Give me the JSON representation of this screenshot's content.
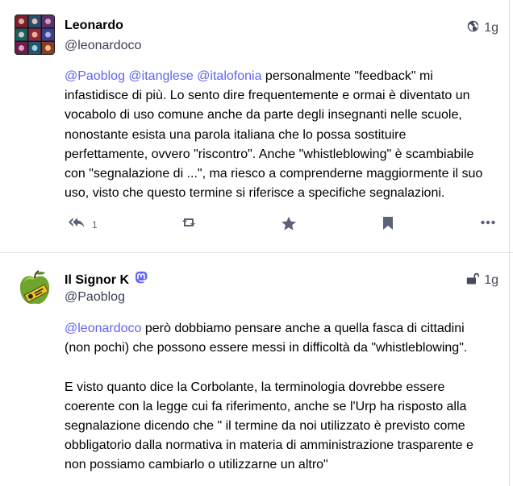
{
  "posts": [
    {
      "author": "Leonardo",
      "handle": "@leonardoco",
      "visibility_icon": "globe-icon",
      "time": "1g",
      "mentions": [
        "@Paoblog",
        "@itanglese",
        "@italofonia"
      ],
      "text": " personalmente \"feedback\" mi infastidisce di più. Lo sento dire frequentemente e ormai è diventato un vocabolo di uso comune anche da parte degli insegnanti nelle scuole, nonostante esista una parola italiana che lo possa sostituire perfettamente, ovvero \"riscontro\". Anche \"whistleblowing\"  è scambiabile con \"segnalazione di ...\", ma riesco a comprenderne maggiormente il suo uso, visto che questo termine si riferisce a specifiche segnalazioni.",
      "reply_count": "1"
    },
    {
      "author": "Il Signor K",
      "handle": "@Paoblog",
      "badge_icon": "mastodon-icon",
      "visibility_icon": "unlock-icon",
      "time": "1g",
      "mentions": [
        "@leonardoco"
      ],
      "text": " però dobbiamo pensare anche a quella fasca di cittadini (non pochi) che possono essere messi in difficoltà da \"whistleblowing\".",
      "text2": "E visto quanto dice la Corbolante, la terminologia dovrebbe essere coerente con la legge cui fa riferimento, anche se l'Urp ha risposto alla segnalazione dicendo che \" il termine da noi utilizzato è previsto come obbligatorio dalla normativa in materia di amministrazione trasparente e non possiamo cambiarlo o utilizzarne un altro\""
    }
  ],
  "colors": {
    "mention": "#5f64ef",
    "icon": "#5b6179",
    "divider": "#dde0ea"
  }
}
